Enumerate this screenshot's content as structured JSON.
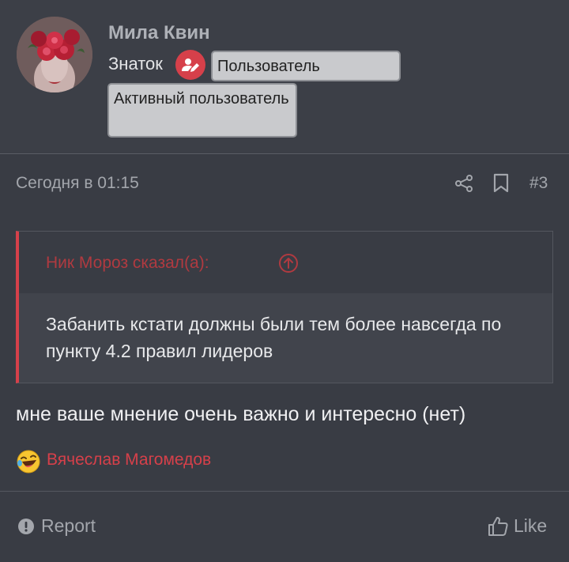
{
  "author": {
    "name": "Мила Квин",
    "rank": "Знаток",
    "rank_badge_icon": "user-edit-icon",
    "tags": [
      "Пользователь",
      "Активный пользователь"
    ],
    "avatar_icon": "avatar-roses"
  },
  "meta": {
    "date": "Сегодня в 01:15",
    "share_icon": "share-icon",
    "bookmark_icon": "bookmark-icon",
    "post_number": "#3"
  },
  "quote": {
    "author_line": "Ник Мороз сказал(а):",
    "jump_icon": "arrow-up-circle-icon",
    "text": "Забанить кстати должны были тем более навсегда по пункту 4.2 правил лидеров"
  },
  "message": "мне ваше мнение очень важно и интересно (нет)",
  "reaction": {
    "icon": "laughing-emoji-icon",
    "user": "Вячеслав Магомедов"
  },
  "footer": {
    "report_label": "Report",
    "report_icon": "alert-circle-icon",
    "like_label": "Like",
    "like_icon": "thumbs-up-icon"
  },
  "colors": {
    "background": "#393c44",
    "accent": "#d6404a",
    "quote_author": "#b03a40",
    "tag_bg": "#c9cacd"
  }
}
